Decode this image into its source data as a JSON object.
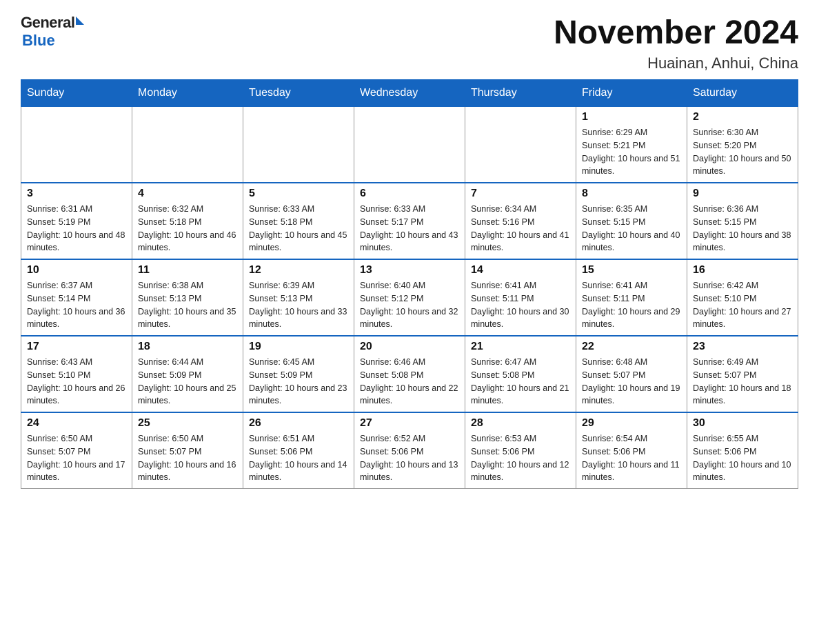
{
  "header": {
    "logo_general": "General",
    "logo_blue": "Blue",
    "month_title": "November 2024",
    "location": "Huainan, Anhui, China"
  },
  "weekdays": [
    "Sunday",
    "Monday",
    "Tuesday",
    "Wednesday",
    "Thursday",
    "Friday",
    "Saturday"
  ],
  "weeks": [
    [
      {
        "day": "",
        "info": ""
      },
      {
        "day": "",
        "info": ""
      },
      {
        "day": "",
        "info": ""
      },
      {
        "day": "",
        "info": ""
      },
      {
        "day": "",
        "info": ""
      },
      {
        "day": "1",
        "info": "Sunrise: 6:29 AM\nSunset: 5:21 PM\nDaylight: 10 hours and 51 minutes."
      },
      {
        "day": "2",
        "info": "Sunrise: 6:30 AM\nSunset: 5:20 PM\nDaylight: 10 hours and 50 minutes."
      }
    ],
    [
      {
        "day": "3",
        "info": "Sunrise: 6:31 AM\nSunset: 5:19 PM\nDaylight: 10 hours and 48 minutes."
      },
      {
        "day": "4",
        "info": "Sunrise: 6:32 AM\nSunset: 5:18 PM\nDaylight: 10 hours and 46 minutes."
      },
      {
        "day": "5",
        "info": "Sunrise: 6:33 AM\nSunset: 5:18 PM\nDaylight: 10 hours and 45 minutes."
      },
      {
        "day": "6",
        "info": "Sunrise: 6:33 AM\nSunset: 5:17 PM\nDaylight: 10 hours and 43 minutes."
      },
      {
        "day": "7",
        "info": "Sunrise: 6:34 AM\nSunset: 5:16 PM\nDaylight: 10 hours and 41 minutes."
      },
      {
        "day": "8",
        "info": "Sunrise: 6:35 AM\nSunset: 5:15 PM\nDaylight: 10 hours and 40 minutes."
      },
      {
        "day": "9",
        "info": "Sunrise: 6:36 AM\nSunset: 5:15 PM\nDaylight: 10 hours and 38 minutes."
      }
    ],
    [
      {
        "day": "10",
        "info": "Sunrise: 6:37 AM\nSunset: 5:14 PM\nDaylight: 10 hours and 36 minutes."
      },
      {
        "day": "11",
        "info": "Sunrise: 6:38 AM\nSunset: 5:13 PM\nDaylight: 10 hours and 35 minutes."
      },
      {
        "day": "12",
        "info": "Sunrise: 6:39 AM\nSunset: 5:13 PM\nDaylight: 10 hours and 33 minutes."
      },
      {
        "day": "13",
        "info": "Sunrise: 6:40 AM\nSunset: 5:12 PM\nDaylight: 10 hours and 32 minutes."
      },
      {
        "day": "14",
        "info": "Sunrise: 6:41 AM\nSunset: 5:11 PM\nDaylight: 10 hours and 30 minutes."
      },
      {
        "day": "15",
        "info": "Sunrise: 6:41 AM\nSunset: 5:11 PM\nDaylight: 10 hours and 29 minutes."
      },
      {
        "day": "16",
        "info": "Sunrise: 6:42 AM\nSunset: 5:10 PM\nDaylight: 10 hours and 27 minutes."
      }
    ],
    [
      {
        "day": "17",
        "info": "Sunrise: 6:43 AM\nSunset: 5:10 PM\nDaylight: 10 hours and 26 minutes."
      },
      {
        "day": "18",
        "info": "Sunrise: 6:44 AM\nSunset: 5:09 PM\nDaylight: 10 hours and 25 minutes."
      },
      {
        "day": "19",
        "info": "Sunrise: 6:45 AM\nSunset: 5:09 PM\nDaylight: 10 hours and 23 minutes."
      },
      {
        "day": "20",
        "info": "Sunrise: 6:46 AM\nSunset: 5:08 PM\nDaylight: 10 hours and 22 minutes."
      },
      {
        "day": "21",
        "info": "Sunrise: 6:47 AM\nSunset: 5:08 PM\nDaylight: 10 hours and 21 minutes."
      },
      {
        "day": "22",
        "info": "Sunrise: 6:48 AM\nSunset: 5:07 PM\nDaylight: 10 hours and 19 minutes."
      },
      {
        "day": "23",
        "info": "Sunrise: 6:49 AM\nSunset: 5:07 PM\nDaylight: 10 hours and 18 minutes."
      }
    ],
    [
      {
        "day": "24",
        "info": "Sunrise: 6:50 AM\nSunset: 5:07 PM\nDaylight: 10 hours and 17 minutes."
      },
      {
        "day": "25",
        "info": "Sunrise: 6:50 AM\nSunset: 5:07 PM\nDaylight: 10 hours and 16 minutes."
      },
      {
        "day": "26",
        "info": "Sunrise: 6:51 AM\nSunset: 5:06 PM\nDaylight: 10 hours and 14 minutes."
      },
      {
        "day": "27",
        "info": "Sunrise: 6:52 AM\nSunset: 5:06 PM\nDaylight: 10 hours and 13 minutes."
      },
      {
        "day": "28",
        "info": "Sunrise: 6:53 AM\nSunset: 5:06 PM\nDaylight: 10 hours and 12 minutes."
      },
      {
        "day": "29",
        "info": "Sunrise: 6:54 AM\nSunset: 5:06 PM\nDaylight: 10 hours and 11 minutes."
      },
      {
        "day": "30",
        "info": "Sunrise: 6:55 AM\nSunset: 5:06 PM\nDaylight: 10 hours and 10 minutes."
      }
    ]
  ]
}
